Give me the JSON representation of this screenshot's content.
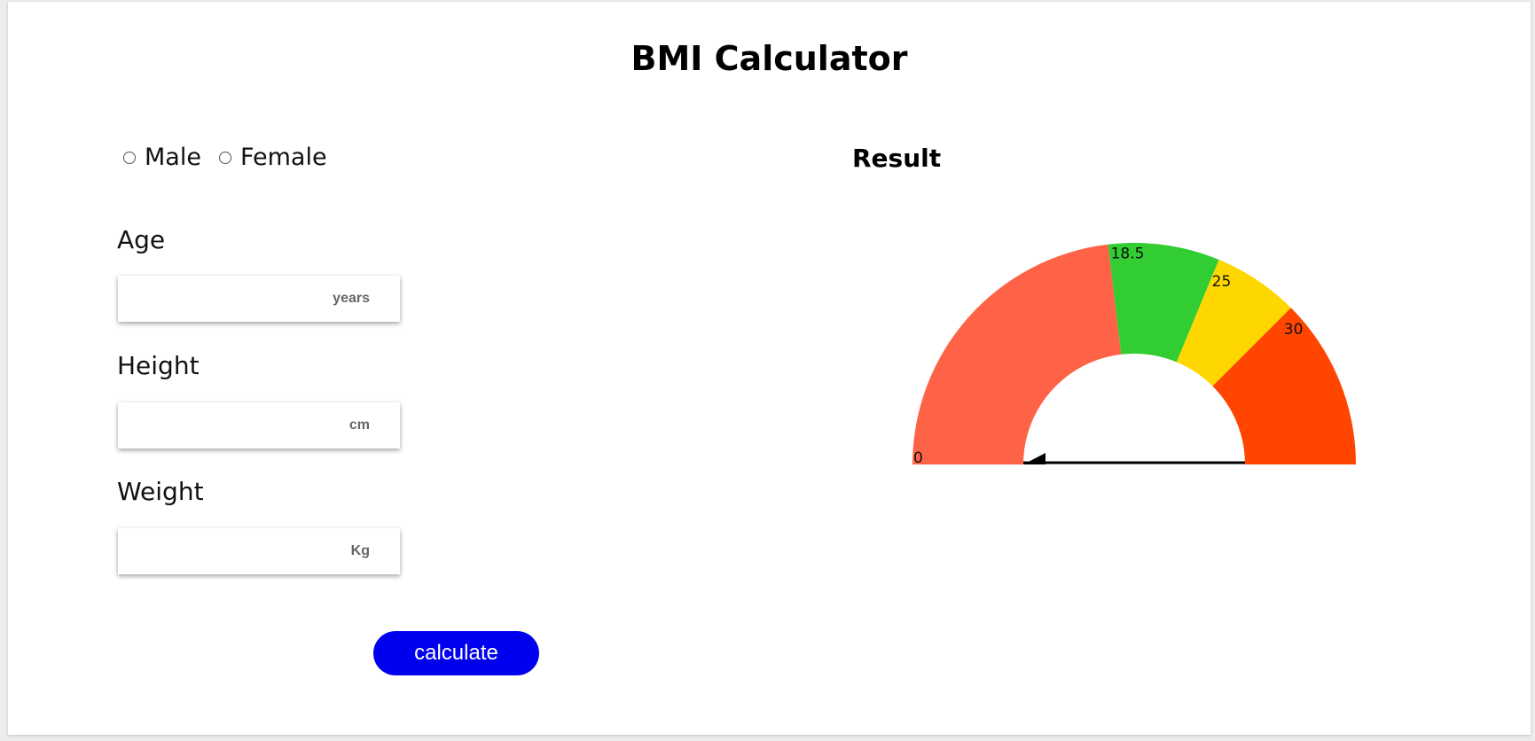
{
  "page": {
    "title": "BMI Calculator"
  },
  "gender": {
    "options": [
      "Male",
      "Female"
    ],
    "selected": null
  },
  "fields": {
    "age": {
      "label": "Age",
      "unit": "years",
      "value": ""
    },
    "height": {
      "label": "Height",
      "unit": "cm",
      "value": ""
    },
    "weight": {
      "label": "Weight",
      "unit": "Kg",
      "value": ""
    }
  },
  "button": {
    "label": "calculate"
  },
  "result": {
    "title": "Result",
    "gauge": {
      "min": 0,
      "max": 40,
      "segments": [
        {
          "from": 0,
          "to": 18.5,
          "color": "#ff6347"
        },
        {
          "from": 18.5,
          "to": 25,
          "color": "#32cd32"
        },
        {
          "from": 25,
          "to": 30,
          "color": "#ffd700"
        },
        {
          "from": 30,
          "to": 40,
          "color": "#ff4500"
        }
      ],
      "tick_labels": [
        "0",
        "18.5",
        "25",
        "30"
      ],
      "needle_value": 0
    }
  }
}
